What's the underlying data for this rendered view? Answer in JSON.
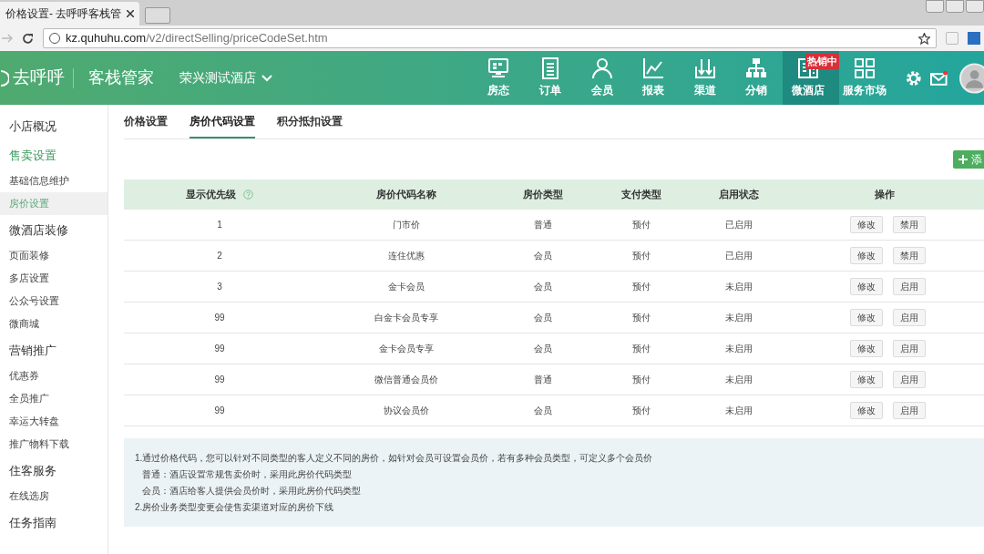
{
  "browser": {
    "tab_title": "价格设置- 去呼呼客栈管",
    "url_host": "kz.quhuhu.com",
    "url_path": "/v2/directSelling/priceCodeSet.htm"
  },
  "header": {
    "logo": "去呼呼",
    "product": "客栈管家",
    "hotel": "荣兴测试酒店",
    "nav": [
      {
        "label": "房态",
        "selected": false
      },
      {
        "label": "订单",
        "selected": false
      },
      {
        "label": "会员",
        "selected": false
      },
      {
        "label": "报表",
        "selected": false
      },
      {
        "label": "渠道",
        "selected": false
      },
      {
        "label": "分销",
        "selected": false
      },
      {
        "label": "微酒店",
        "selected": true,
        "badge": "热销中"
      },
      {
        "label": "服务市场",
        "selected": false
      }
    ]
  },
  "sidebar": {
    "items": [
      {
        "kind": "section",
        "label": "小店概况",
        "active": false
      },
      {
        "kind": "section",
        "label": "售卖设置",
        "active": true
      },
      {
        "kind": "item",
        "label": "基础信息维护",
        "selected": false
      },
      {
        "kind": "item",
        "label": "房价设置",
        "selected": true
      },
      {
        "kind": "section",
        "label": "微酒店装修",
        "active": false
      },
      {
        "kind": "item",
        "label": "页面装修",
        "selected": false
      },
      {
        "kind": "item",
        "label": "多店设置",
        "selected": false
      },
      {
        "kind": "item",
        "label": "公众号设置",
        "selected": false
      },
      {
        "kind": "item",
        "label": "微商城",
        "selected": false
      },
      {
        "kind": "section",
        "label": "营销推广",
        "active": false
      },
      {
        "kind": "item",
        "label": "优惠券",
        "selected": false
      },
      {
        "kind": "item",
        "label": "全员推广",
        "selected": false
      },
      {
        "kind": "item",
        "label": "幸运大转盘",
        "selected": false
      },
      {
        "kind": "item",
        "label": "推广物料下载",
        "selected": false
      },
      {
        "kind": "section",
        "label": "住客服务",
        "active": false
      },
      {
        "kind": "item",
        "label": "在线选房",
        "selected": false
      },
      {
        "kind": "section",
        "label": "任务指南",
        "active": false
      }
    ]
  },
  "tabs": [
    {
      "label": "价格设置",
      "selected": false
    },
    {
      "label": "房价代码设置",
      "selected": true
    },
    {
      "label": "积分抵扣设置",
      "selected": false
    }
  ],
  "add_button": "添",
  "table": {
    "columns": [
      "显示优先级",
      "房价代码名称",
      "房价类型",
      "支付类型",
      "启用状态",
      "操作"
    ],
    "rows": [
      {
        "cells": [
          "1",
          "门市价",
          "普通",
          "预付",
          "已启用"
        ],
        "actions": [
          "修改",
          "禁用"
        ]
      },
      {
        "cells": [
          "2",
          "连住优惠",
          "会员",
          "预付",
          "已启用"
        ],
        "actions": [
          "修改",
          "禁用"
        ]
      },
      {
        "cells": [
          "3",
          "金卡会员",
          "会员",
          "预付",
          "未启用"
        ],
        "actions": [
          "修改",
          "启用"
        ]
      },
      {
        "cells": [
          "99",
          "白金卡会员专享",
          "会员",
          "预付",
          "未启用"
        ],
        "actions": [
          "修改",
          "启用"
        ]
      },
      {
        "cells": [
          "99",
          "金卡会员专享",
          "会员",
          "预付",
          "未启用"
        ],
        "actions": [
          "修改",
          "启用"
        ]
      },
      {
        "cells": [
          "99",
          "微信普通会员价",
          "普通",
          "预付",
          "未启用"
        ],
        "actions": [
          "修改",
          "启用"
        ]
      },
      {
        "cells": [
          "99",
          "协议会员价",
          "会员",
          "预付",
          "未启用"
        ],
        "actions": [
          "修改",
          "启用"
        ]
      }
    ]
  },
  "notes": [
    "1.通过价格代码，您可以针对不同类型的客人定义不同的房价，如针对会员可设置会员价，若有多种会员类型，可定义多个会员价",
    "普通：酒店设置常规售卖价时，采用此房价代码类型",
    "会员：酒店给客人提供会员价时，采用此房价代码类型",
    "2.房价业务类型变更会使售卖渠道对应的房价下线"
  ]
}
